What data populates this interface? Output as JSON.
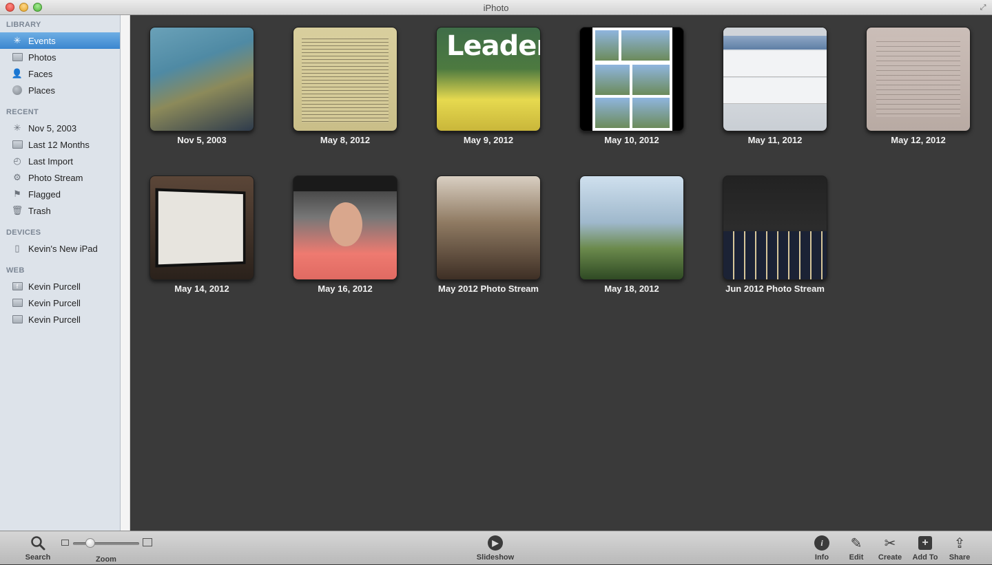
{
  "window": {
    "title": "iPhoto"
  },
  "sidebar": {
    "sections": [
      {
        "header": "LIBRARY",
        "items": [
          {
            "label": "Events",
            "icon": "events-icon",
            "selected": true
          },
          {
            "label": "Photos",
            "icon": "photos-icon"
          },
          {
            "label": "Faces",
            "icon": "faces-icon"
          },
          {
            "label": "Places",
            "icon": "places-icon"
          }
        ]
      },
      {
        "header": "RECENT",
        "items": [
          {
            "label": "Nov 5, 2003",
            "icon": "event-icon"
          },
          {
            "label": "Last 12 Months",
            "icon": "calendar-icon"
          },
          {
            "label": "Last Import",
            "icon": "import-icon"
          },
          {
            "label": "Photo Stream",
            "icon": "photo-stream-icon"
          },
          {
            "label": "Flagged",
            "icon": "flag-icon"
          },
          {
            "label": "Trash",
            "icon": "trash-icon"
          }
        ]
      },
      {
        "header": "DEVICES",
        "items": [
          {
            "label": "Kevin's New iPad",
            "icon": "ipad-icon"
          }
        ]
      },
      {
        "header": "WEB",
        "items": [
          {
            "label": "Kevin Purcell",
            "icon": "facebook-icon"
          },
          {
            "label": "Kevin Purcell",
            "icon": "picasa-icon"
          },
          {
            "label": "Kevin Purcell",
            "icon": "flickr-icon"
          }
        ]
      }
    ]
  },
  "events": [
    {
      "label": "Nov 5, 2003",
      "thumb": "map"
    },
    {
      "label": "May 8, 2012",
      "thumb": "document"
    },
    {
      "label": "May 9, 2012",
      "thumb": "leader-magazine",
      "thumb_text": "Leader"
    },
    {
      "label": "May 10, 2012",
      "thumb": "photo-grid"
    },
    {
      "label": "May 11, 2012",
      "thumb": "phone-screenshot"
    },
    {
      "label": "May 12, 2012",
      "thumb": "paper"
    },
    {
      "label": "May 14, 2012",
      "thumb": "ipad"
    },
    {
      "label": "May 16, 2012",
      "thumb": "portrait"
    },
    {
      "label": "May 2012 Photo Stream",
      "thumb": "church"
    },
    {
      "label": "May 18, 2012",
      "thumb": "landscape"
    },
    {
      "label": "Jun 2012 Photo Stream",
      "thumb": "graduation"
    }
  ],
  "toolbar": {
    "search": "Search",
    "zoom": "Zoom",
    "slideshow": "Slideshow",
    "info": "Info",
    "edit": "Edit",
    "create": "Create",
    "add_to": "Add To",
    "share": "Share"
  }
}
